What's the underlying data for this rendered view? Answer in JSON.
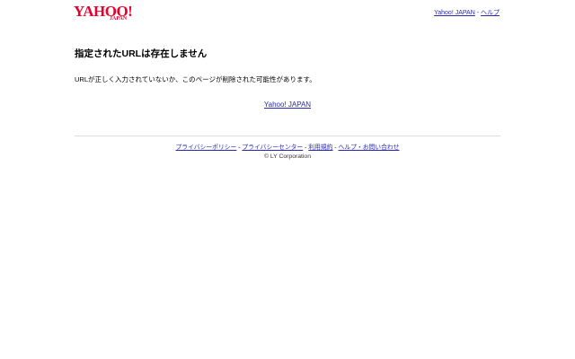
{
  "logo": {
    "main": "YAHOO!",
    "sub": "JAPAN"
  },
  "header": {
    "links": [
      "Yahoo! JAPAN",
      "ヘルプ"
    ],
    "separator": "-"
  },
  "main": {
    "title": "指定されたURLは存在しません",
    "message": "URLが正しく入力されていないか、このページが削除された可能性があります。",
    "home_link": "Yahoo! JAPAN"
  },
  "footer": {
    "links": [
      "プライバシーポリシー",
      "プライバシーセンター",
      "利用規約",
      "ヘルプ・お問い合わせ"
    ],
    "separator": "-",
    "copyright": "© LY Corporation"
  },
  "colors": {
    "brand": "#e6002d",
    "link": "#2a2ab0"
  }
}
